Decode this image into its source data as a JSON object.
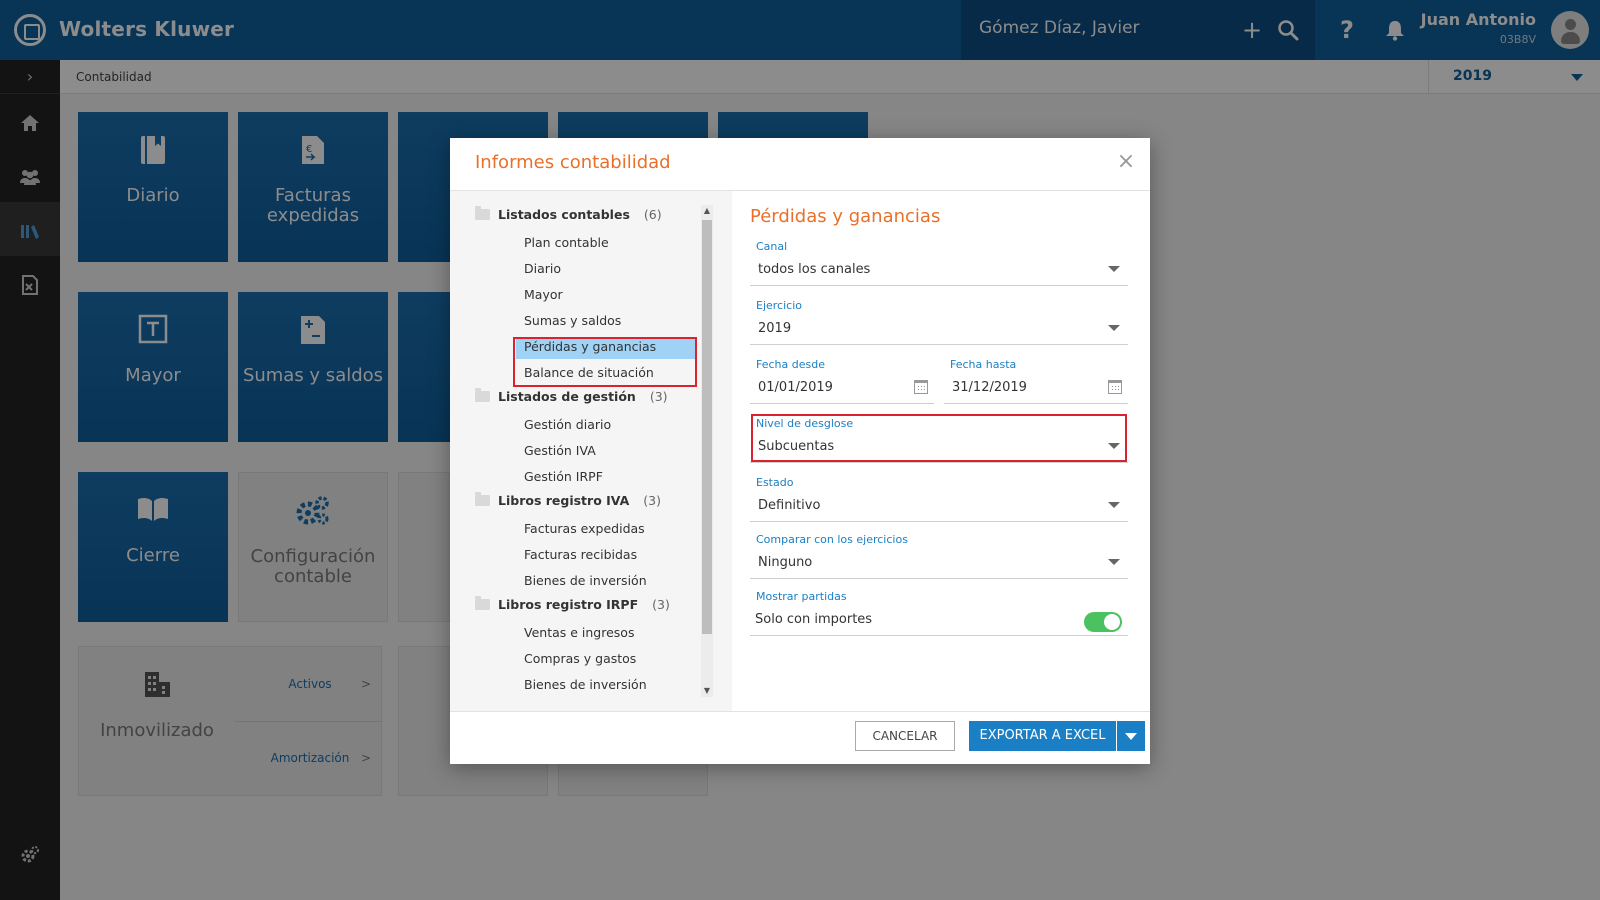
{
  "topbar": {
    "brand": "Wolters Kluwer",
    "client": "Gómez Díaz, Javier",
    "user_name": "Juan Antonio",
    "user_code": "03B8V",
    "icons": [
      "plus-icon",
      "search-icon",
      "help-icon",
      "bell-icon"
    ]
  },
  "breadcrumb": "Contabilidad",
  "year": "2019",
  "sidebar": {
    "items": [
      "home-icon",
      "people-icon",
      "books-icon",
      "spreadsheet-icon",
      "settings-icon"
    ]
  },
  "tiles": {
    "diario": "Diario",
    "facturas_expedidas": "Facturas expedidas",
    "mayor": "Mayor",
    "sumas_saldos": "Sumas y saldos",
    "cierre": "Cierre",
    "configuracion": "Configuración contable",
    "inmovilizado": "Inmovilizado",
    "activos": "Activos",
    "amortizacion": "Amortización",
    "arrow": ">"
  },
  "modal": {
    "title": "Informes contabilidad",
    "close": "×",
    "tree": {
      "groups": [
        {
          "label": "Listados contables",
          "count": "(6)",
          "items": [
            "Plan contable",
            "Diario",
            "Mayor",
            "Sumas y saldos",
            "Pérdidas y ganancias",
            "Balance de situación"
          ]
        },
        {
          "label": "Listados de gestión",
          "count": "(3)",
          "items": [
            "Gestión diario",
            "Gestión IVA",
            "Gestión IRPF"
          ]
        },
        {
          "label": "Libros registro IVA",
          "count": "(3)",
          "items": [
            "Facturas expedidas",
            "Facturas recibidas",
            "Bienes de inversión"
          ]
        },
        {
          "label": "Libros registro IRPF",
          "count": "(3)",
          "items": [
            "Ventas e ingresos",
            "Compras y gastos",
            "Bienes de inversión"
          ]
        }
      ],
      "selected": "Pérdidas y ganancias"
    },
    "form": {
      "title": "Pérdidas y ganancias",
      "canal": {
        "label": "Canal",
        "value": "todos los canales"
      },
      "ejercicio": {
        "label": "Ejercicio",
        "value": "2019"
      },
      "fecha_desde": {
        "label": "Fecha desde",
        "value": "01/01/2019"
      },
      "fecha_hasta": {
        "label": "Fecha hasta",
        "value": "31/12/2019"
      },
      "nivel": {
        "label": "Nivel de desglose",
        "value": "Subcuentas"
      },
      "estado": {
        "label": "Estado",
        "value": "Definitivo"
      },
      "comparar": {
        "label": "Comparar con los ejercicios",
        "value": "Ninguno"
      },
      "mostrar": {
        "label": "Mostrar partidas",
        "value": "Solo con importes",
        "toggle_on": true
      }
    },
    "buttons": {
      "cancel": "CANCELAR",
      "export": "EXPORTAR A EXCEL"
    }
  },
  "colors": {
    "brand_blue": "#0f5f9c",
    "accent_orange": "#e8702a",
    "link_blue": "#1a7fc4",
    "highlight_red": "#d9232e",
    "toggle_green": "#4cc15f",
    "selected_bg": "#9fd2f5"
  }
}
